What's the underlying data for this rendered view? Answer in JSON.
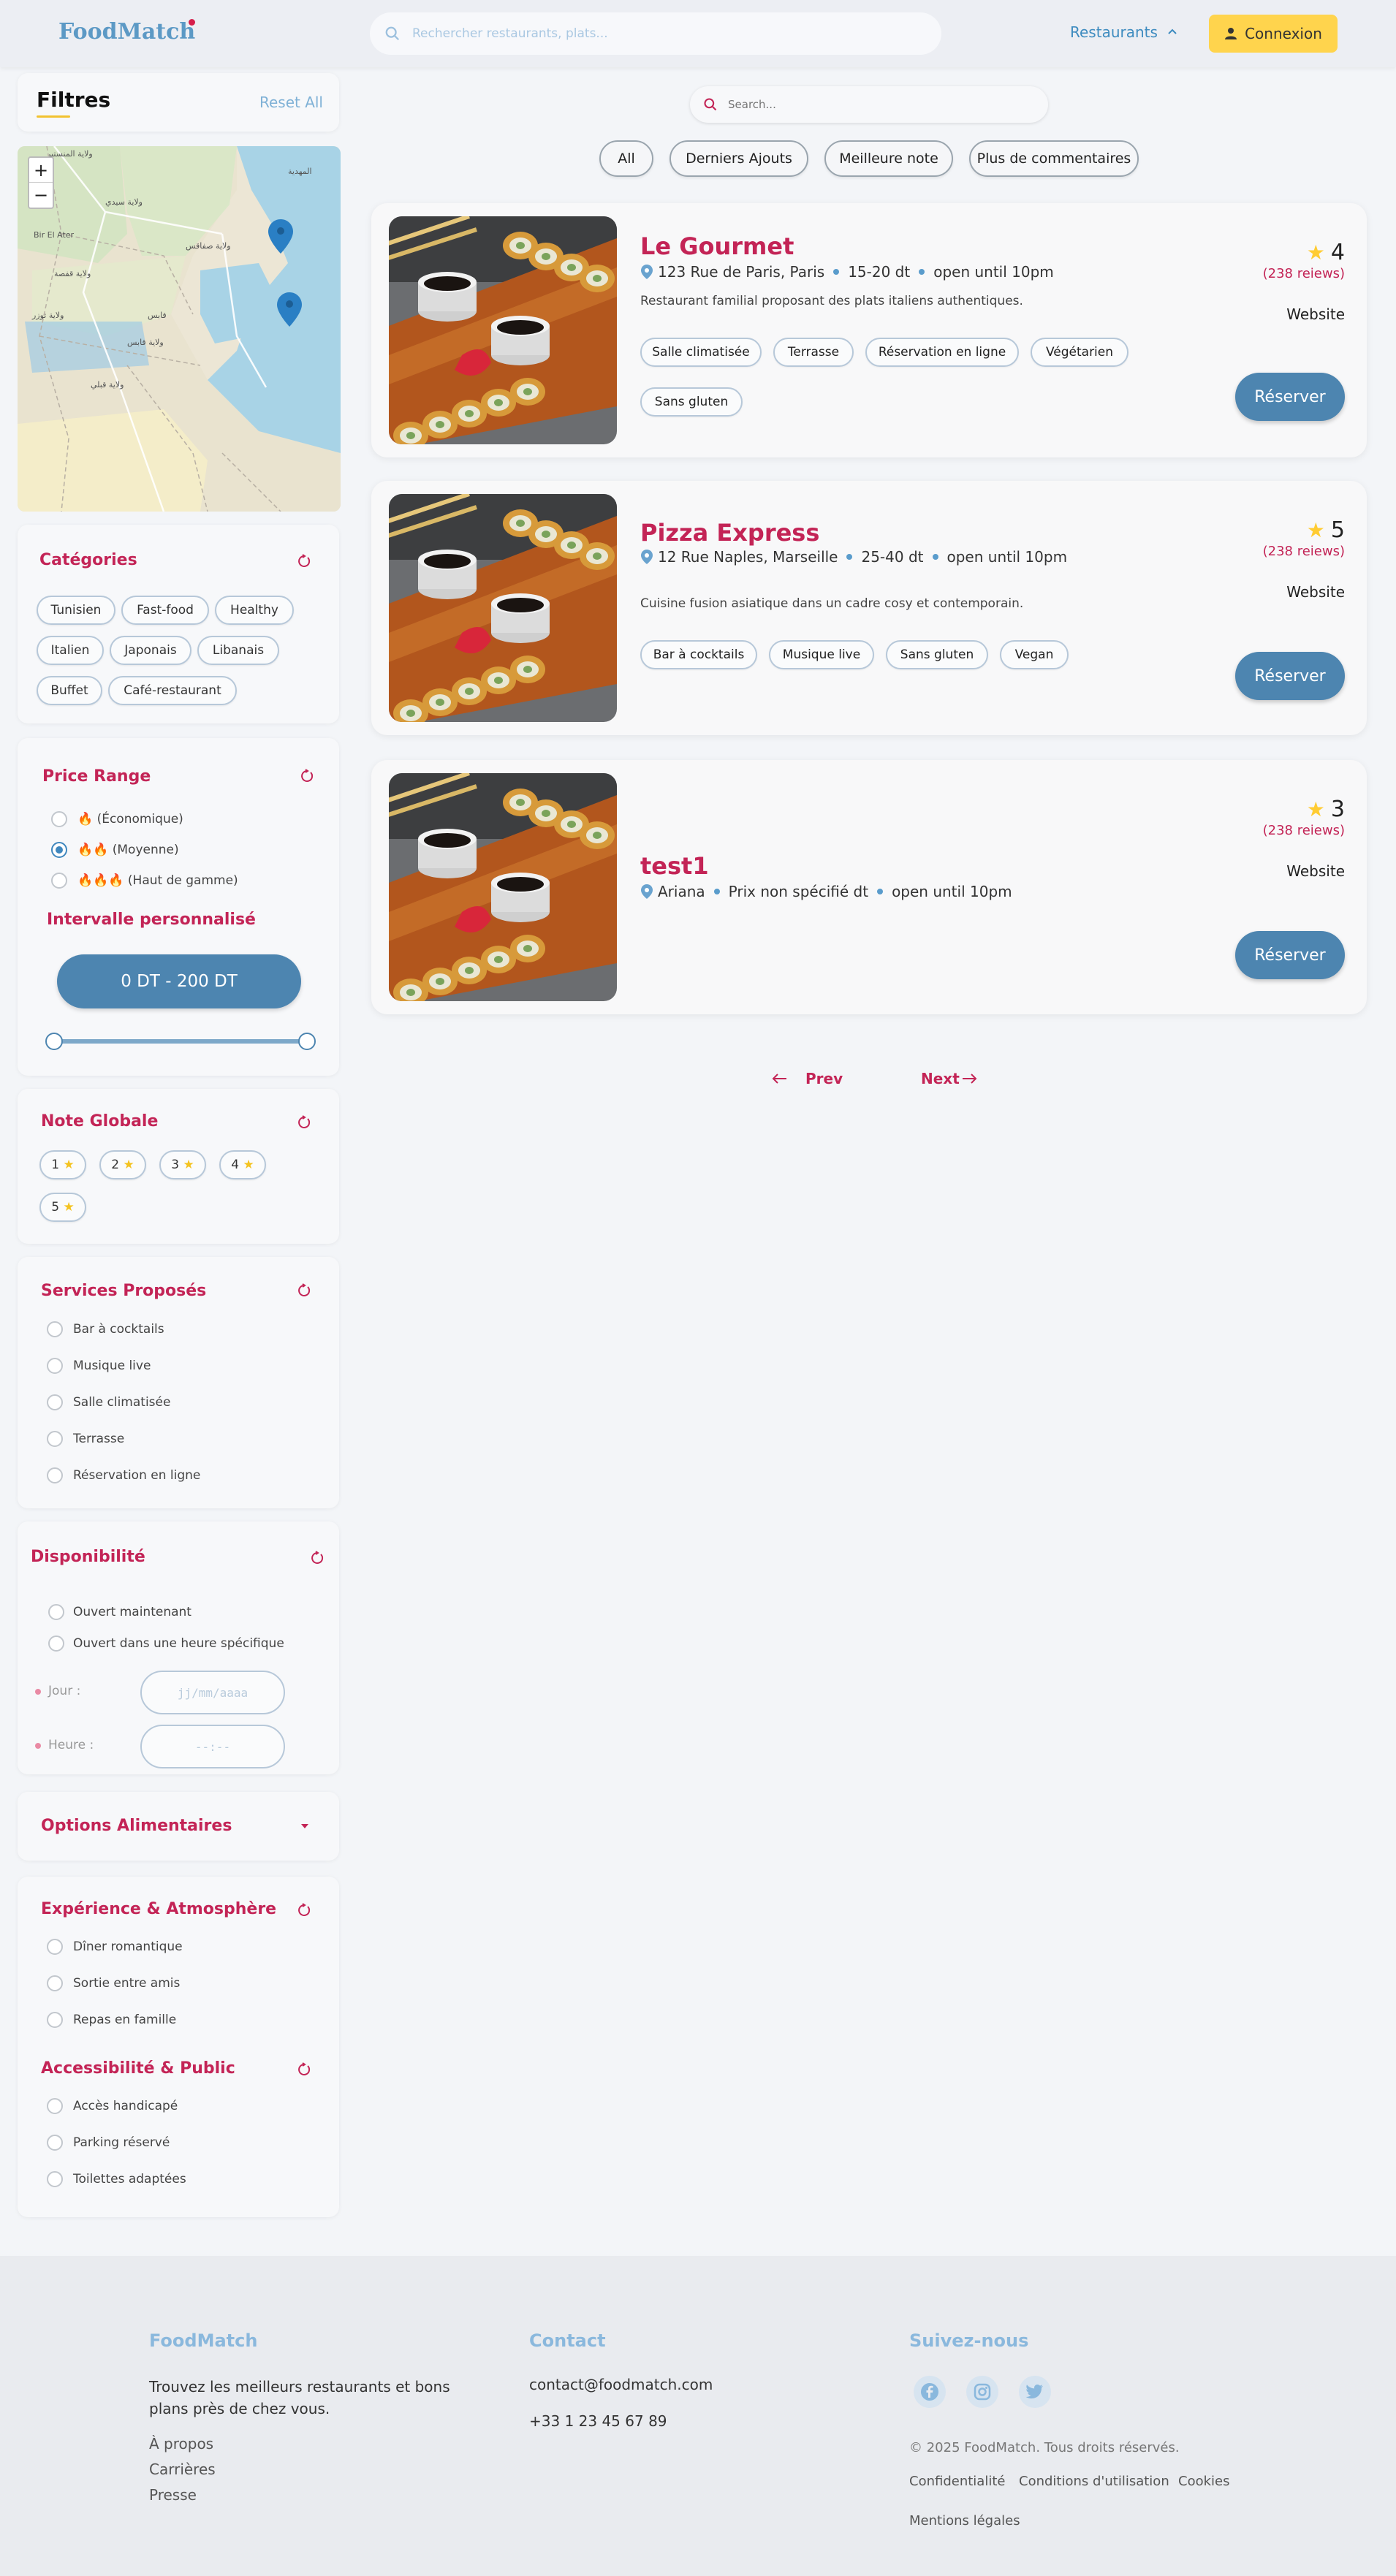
{
  "header": {
    "logo": "FoodMatch",
    "search_placeholder": "Rechercher restaurants, plats...",
    "nav_restaurants": "Restaurants",
    "login_label": "Connexion"
  },
  "sidebar": {
    "title": "Filtres",
    "reset_all": "Reset All",
    "map": {
      "zoom_in": "+",
      "zoom_out": "−",
      "labels": [
        "ولاية المنستير",
        "ولاية سيدي",
        "ولاية صفاقس",
        "Bir El Ater",
        "ولاية قفصة",
        "ولاية توزر",
        "قابس",
        "ولاية قابس",
        "ولاية قبلي",
        "المهدية"
      ]
    },
    "categories": {
      "title": "Catégories",
      "items": [
        "Tunisien",
        "Fast-food",
        "Healthy",
        "Italien",
        "Japonais",
        "Libanais",
        "Buffet",
        "Café-restaurant"
      ]
    },
    "price_range": {
      "title": "Price Range",
      "options": [
        {
          "flames": "🔥",
          "label": "(Économique)",
          "selected": false
        },
        {
          "flames": "🔥🔥",
          "label": "(Moyenne)",
          "selected": true
        },
        {
          "flames": "🔥🔥🔥",
          "label": "(Haut de gamme)",
          "selected": false
        }
      ],
      "custom_title": "Intervalle personnalisé",
      "range_label": "0 DT - 200 DT",
      "slider_min_fraction": 0,
      "slider_max_fraction": 1
    },
    "note": {
      "title": "Note Globale",
      "items": [
        "1",
        "2",
        "3",
        "4",
        "5"
      ]
    },
    "services": {
      "title": "Services Proposés",
      "items": [
        "Bar à cocktails",
        "Musique live",
        "Salle climatisée",
        "Terrasse",
        "Réservation en ligne"
      ]
    },
    "disponibilite": {
      "title": "Disponibilité",
      "options": [
        "Ouvert maintenant",
        "Ouvert dans une heure spécifique"
      ],
      "jour_label": "Jour :",
      "jour_placeholder": "jj/mm/aaaa",
      "heure_label": "Heure :",
      "heure_placeholder": "--:--"
    },
    "options_alimentaires": {
      "title": "Options Alimentaires"
    },
    "experience": {
      "title": "Expérience & Atmosphère",
      "items": [
        "Dîner romantique",
        "Sortie entre amis",
        "Repas en famille"
      ]
    },
    "accessibilite": {
      "title": "Accessibilité & Public",
      "items": [
        "Accès handicapé",
        "Parking réservé",
        "Toilettes adaptées"
      ]
    }
  },
  "main": {
    "search_placeholder": "Search...",
    "filters": [
      "All",
      "Derniers Ajouts",
      "Meilleure note",
      "Plus de commentaires"
    ],
    "restaurants": [
      {
        "name": "Le Gourmet",
        "address": "123 Rue de Paris, Paris",
        "price": "15-20 dt",
        "hours": "open until 10pm",
        "description": "Restaurant familial proposant des plats italiens authentiques.",
        "tags": [
          "Salle climatisée",
          "Terrasse",
          "Réservation en ligne",
          "Végétarien",
          "Sans gluten"
        ],
        "rating": "4",
        "reviews": "(238 reiews)",
        "website": "Website",
        "reserve": "Réserver"
      },
      {
        "name": "Pizza Express",
        "address": "12 Rue Naples, Marseille",
        "price": "25-40 dt",
        "hours": "open until 10pm",
        "description": "Cuisine fusion asiatique dans un cadre cosy et contemporain.",
        "tags": [
          "Bar à cocktails",
          "Musique live",
          "Sans gluten",
          "Vegan"
        ],
        "rating": "5",
        "reviews": "(238 reiews)",
        "website": "Website",
        "reserve": "Réserver"
      },
      {
        "name": "test1",
        "address": "Ariana",
        "price": "Prix non spécifié dt",
        "hours": "open until 10pm",
        "description": "",
        "tags": [],
        "rating": "3",
        "reviews": "(238 reiews)",
        "website": "Website",
        "reserve": "Réserver"
      }
    ],
    "pagination": {
      "prev": "Prev",
      "next": "Next"
    }
  },
  "footer": {
    "brand": "FoodMatch",
    "tagline": "Trouvez les meilleurs restaurants et bons plans près de chez vous.",
    "links": [
      "À propos",
      "Carrières",
      "Presse"
    ],
    "contact_title": "Contact",
    "email": "contact@foodmatch.com",
    "phone": "+33 1 23 45 67 89",
    "follow_title": "Suivez-nous",
    "social": [
      "facebook-icon",
      "instagram-icon",
      "twitter-icon"
    ],
    "copyright": "© 2025 FoodMatch. Tous droits réservés.",
    "legal": [
      "Confidentialité",
      "Conditions d'utilisation",
      "Cookies",
      "Mentions légales"
    ]
  },
  "colors": {
    "accent": "#c32456",
    "brand_blue": "#5c99c5",
    "button_blue": "#4d85b0",
    "login_yellow": "#ffd44d",
    "star": "#ffcc33"
  }
}
